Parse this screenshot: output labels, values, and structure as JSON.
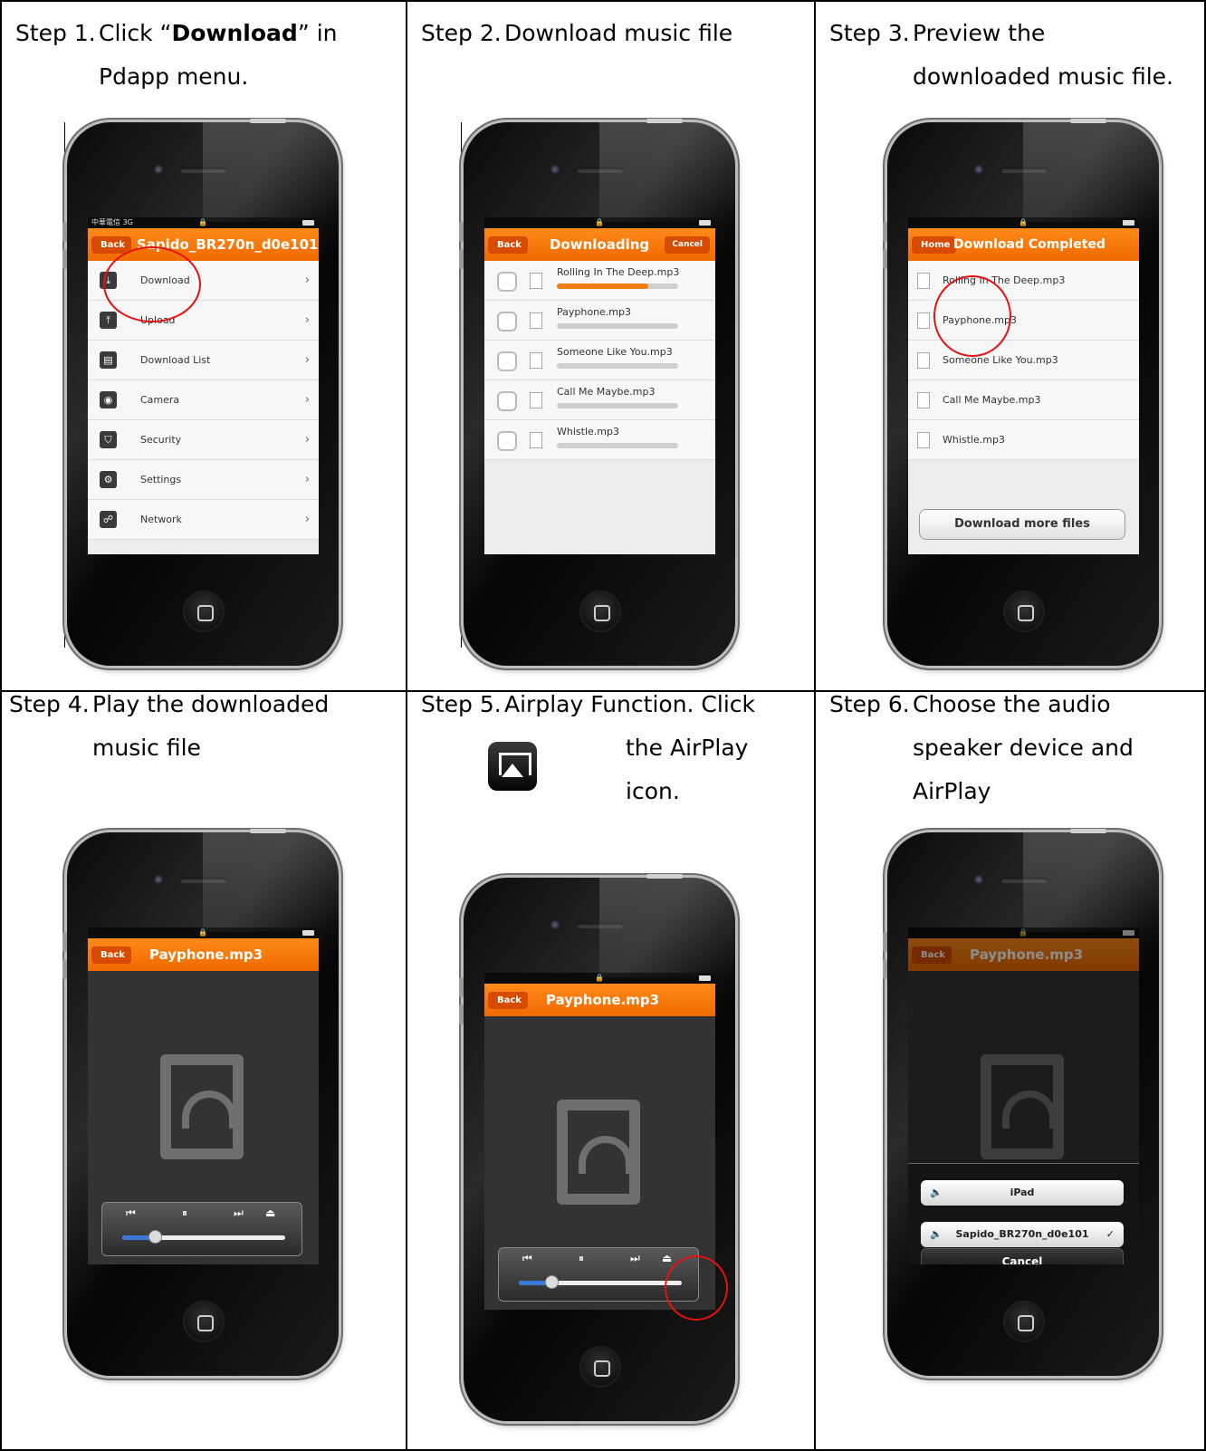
{
  "steps": [
    {
      "num": "Step 1.",
      "lines": [
        "Click “",
        "Download",
        "” in",
        "Pdapp menu."
      ],
      "screen": {
        "back": "Back",
        "title": "Sapido_BR270n_d0e101",
        "carrier": "中華電信 3G",
        "menu": [
          {
            "label": "Download",
            "icon": "download-icon"
          },
          {
            "label": "Upload",
            "icon": "upload-icon"
          },
          {
            "label": "Download List",
            "icon": "list-icon"
          },
          {
            "label": "Camera",
            "icon": "eye-icon"
          },
          {
            "label": "Security",
            "icon": "shield-icon"
          },
          {
            "label": "Settings",
            "icon": "gear-icon"
          },
          {
            "label": "Network",
            "icon": "network-icon"
          }
        ]
      }
    },
    {
      "num": "Step 2.",
      "lines": [
        "Download music file"
      ],
      "screen": {
        "back": "Back",
        "title": "Downloading",
        "cancel": "Cancel",
        "files": [
          {
            "name": "Rolling In The Deep.mp3",
            "progress": 0.75
          },
          {
            "name": "Payphone.mp3",
            "progress": 0
          },
          {
            "name": "Someone Like You.mp3",
            "progress": 0
          },
          {
            "name": "Call Me Maybe.mp3",
            "progress": 0
          },
          {
            "name": "Whistle.mp3",
            "progress": 0
          }
        ]
      }
    },
    {
      "num": "Step 3.",
      "lines": [
        "Preview the",
        "downloaded music file."
      ],
      "screen": {
        "home": "Home",
        "title": "Download Completed",
        "files": [
          "Rolling In The Deep.mp3",
          "Payphone.mp3",
          "Someone Like You.mp3",
          "Call Me Maybe.mp3",
          "Whistle.mp3"
        ],
        "more": "Download more files"
      }
    },
    {
      "num": "Step 4.",
      "lines": [
        "Play the downloaded",
        "music file"
      ],
      "screen": {
        "back": "Back",
        "title": "Payphone.mp3",
        "position": 0.2
      }
    },
    {
      "num": "Step 5.",
      "lines": [
        "Airplay Function. Click",
        "the AirPlay",
        "icon."
      ],
      "screen": {
        "back": "Back",
        "title": "Payphone.mp3",
        "position": 0.2
      }
    },
    {
      "num": "Step 6.",
      "lines": [
        "Choose the audio",
        "speaker device and",
        "AirPlay"
      ],
      "screen": {
        "back": "Back",
        "title": "Payphone.mp3",
        "options": [
          "iPad",
          "Sapido_BR270n_d0e101"
        ],
        "cancel": "Cancel"
      }
    }
  ]
}
